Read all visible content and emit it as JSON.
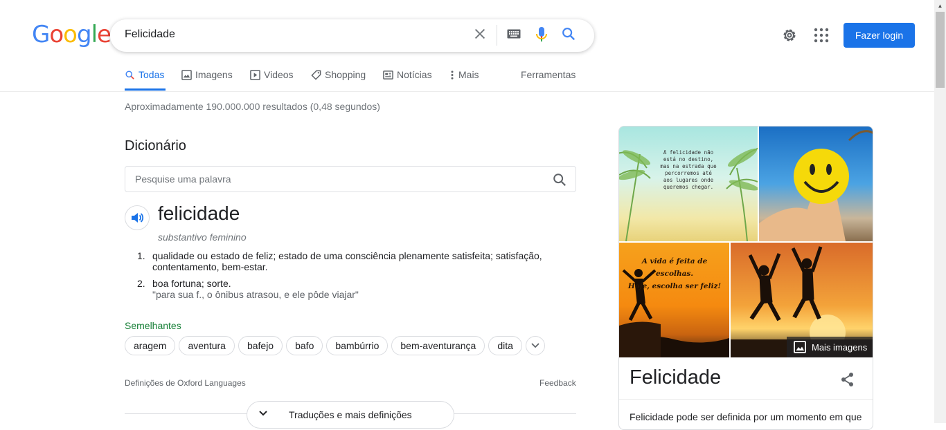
{
  "logo": "Google",
  "search": {
    "query": "Felicidade"
  },
  "header": {
    "login_label": "Fazer login"
  },
  "tabs": [
    {
      "label": "Todas",
      "icon": "search-icon",
      "active": true
    },
    {
      "label": "Imagens",
      "icon": "image-icon"
    },
    {
      "label": "Videos",
      "icon": "play-icon"
    },
    {
      "label": "Shopping",
      "icon": "tag-icon"
    },
    {
      "label": "Notícias",
      "icon": "news-icon"
    },
    {
      "label": "Mais",
      "icon": "more-vert-icon"
    },
    {
      "label": "Ferramentas"
    }
  ],
  "result_stats": "Aproximadamente 190.000.000 resultados (0,48 segundos)",
  "dictionary": {
    "title": "Dicionário",
    "search_placeholder": "Pesquise uma palavra",
    "word": "felicidade",
    "part_of_speech": "substantivo feminino",
    "definitions": [
      {
        "num": "1.",
        "line1": "qualidade ou estado de feliz; estado de uma consciência plenamente satisfeita; satisfação,",
        "line2": "contentamento, bem-estar."
      },
      {
        "num": "2.",
        "line1": "boa fortuna; sorte.",
        "line2": "\"para sua f., o ônibus atrasou, e ele pôde viajar\""
      }
    ],
    "similar_label": "Semelhantes",
    "similar": [
      "aragem",
      "aventura",
      "bafejo",
      "bafo",
      "bambúrrio",
      "bem-aventurança",
      "dita"
    ],
    "source": "Definições de Oxford Languages",
    "feedback": "Feedback",
    "more_button": "Traduções e mais definições"
  },
  "knowledge_panel": {
    "image1_quote": "A felicidade não está no destino, mas na estrada que percorremos até aos lugares onde queremos chegar.",
    "image3_quote_line1": "A vida é feita de escolhas.",
    "image3_quote_line2": "Hoje, escolha ser feliz!",
    "more_images": "Mais imagens",
    "title": "Felicidade",
    "description": "Felicidade pode ser definida por um momento em que"
  },
  "colors": {
    "accent": "#1a73e8",
    "green": "#188038"
  }
}
